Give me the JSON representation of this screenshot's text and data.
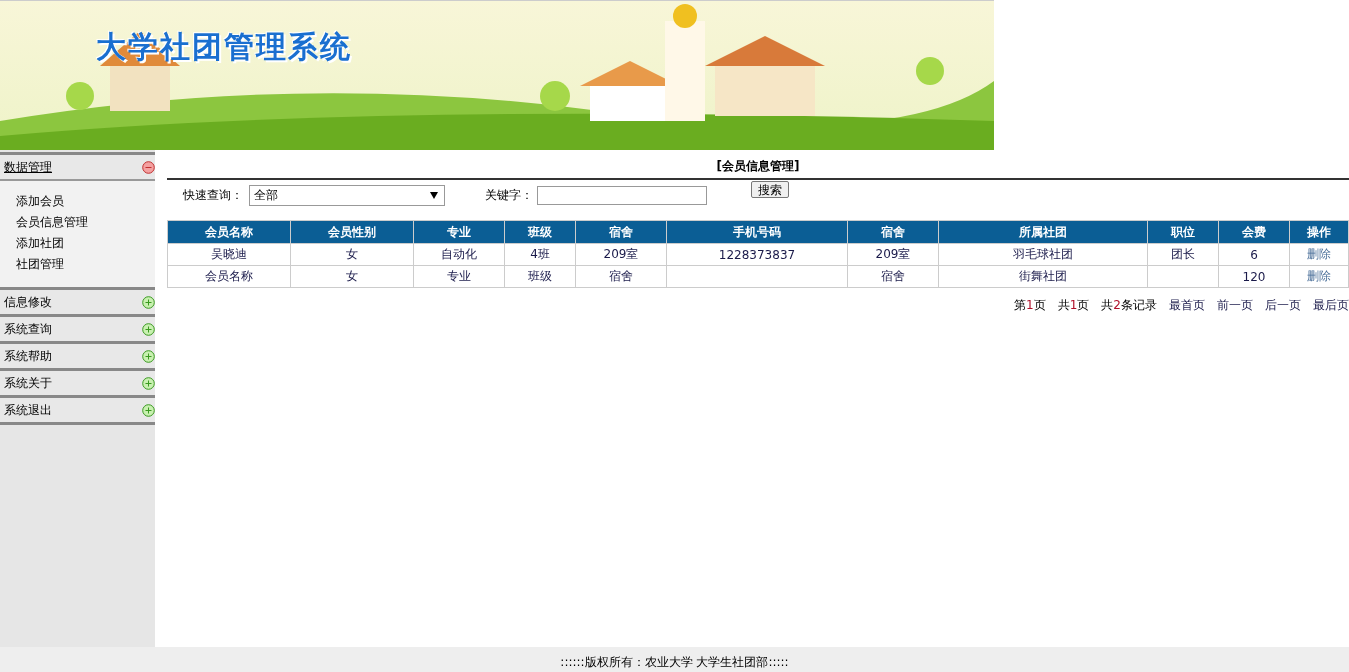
{
  "banner": {
    "title": "大学社团管理系统"
  },
  "sidebar": {
    "sections": [
      {
        "label": "数据管理",
        "expanded": true,
        "children": [
          {
            "label": "添加会员"
          },
          {
            "label": "会员信息管理"
          },
          {
            "label": "添加社团"
          },
          {
            "label": "社团管理"
          }
        ]
      },
      {
        "label": "信息修改",
        "expanded": false
      },
      {
        "label": "系统查询",
        "expanded": false
      },
      {
        "label": "系统帮助",
        "expanded": false
      },
      {
        "label": "系统关于",
        "expanded": false
      },
      {
        "label": "系统退出",
        "expanded": false
      }
    ]
  },
  "page_title": "[会员信息管理]",
  "search": {
    "quick_label": "快速查询：",
    "quick_value": "全部",
    "keyword_label": "关键字：",
    "button": "搜索"
  },
  "table": {
    "columns": [
      "会员名称",
      "会员性别",
      "专业",
      "班级",
      "宿舍",
      "手机号码",
      "宿舍",
      "所属社团",
      "职位",
      "会费",
      "操作"
    ],
    "rows": [
      {
        "cells": [
          "吴晓迪",
          "女",
          "自动化",
          "4班",
          "209室",
          "1228373837",
          "209室",
          "羽毛球社团",
          "团长",
          "6"
        ],
        "action": "删除"
      },
      {
        "cells": [
          "会员名称",
          "女",
          "专业",
          "班级",
          "宿舍",
          "",
          "宿舍",
          "街舞社团",
          "",
          "120"
        ],
        "action": "删除"
      }
    ]
  },
  "pager": [
    {
      "before": "第",
      "num": "1",
      "after": "页",
      "kind": "info"
    },
    {
      "before": "共",
      "num": "1",
      "after": "页",
      "kind": "info"
    },
    {
      "before": "共",
      "num": "2",
      "after": "条记录",
      "kind": "info"
    },
    {
      "before": "最首页",
      "kind": "link"
    },
    {
      "before": "前一页",
      "kind": "link"
    },
    {
      "before": "后一页",
      "kind": "link"
    },
    {
      "before": "最后页",
      "kind": "link"
    }
  ],
  "footer": "::::::版权所有：农业大学 大学生社团部:::::"
}
